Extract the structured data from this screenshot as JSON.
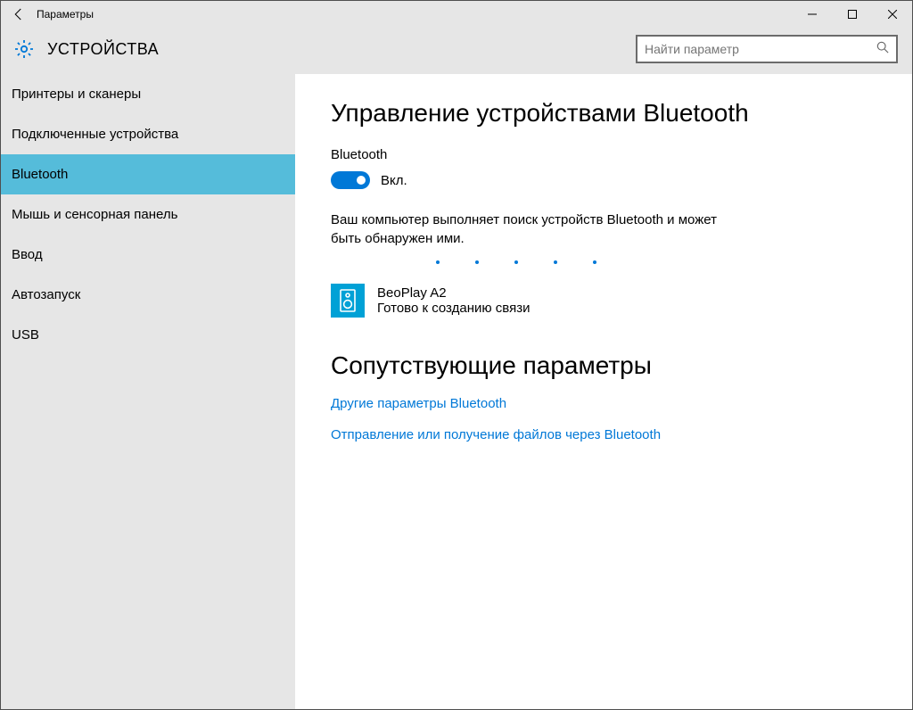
{
  "window": {
    "title": "Параметры"
  },
  "header": {
    "title": "УСТРОЙСТВА",
    "search_placeholder": "Найти параметр"
  },
  "sidebar": {
    "items": [
      {
        "label": "Принтеры и сканеры"
      },
      {
        "label": "Подключенные устройства"
      },
      {
        "label": "Bluetooth"
      },
      {
        "label": "Мышь и сенсорная панель"
      },
      {
        "label": "Ввод"
      },
      {
        "label": "Автозапуск"
      },
      {
        "label": "USB"
      }
    ]
  },
  "main": {
    "heading": "Управление устройствами Bluetooth",
    "toggle_caption": "Bluetooth",
    "toggle_state": "Вкл.",
    "status_text": "Ваш компьютер выполняет поиск устройств Bluetooth и может быть обнаружен ими.",
    "device": {
      "name": "BeoPlay A2",
      "status": "Готово к созданию связи"
    },
    "related_heading": "Сопутствующие параметры",
    "links": [
      {
        "label": "Другие параметры Bluetooth"
      },
      {
        "label": "Отправление или получение файлов через Bluetooth"
      }
    ]
  }
}
